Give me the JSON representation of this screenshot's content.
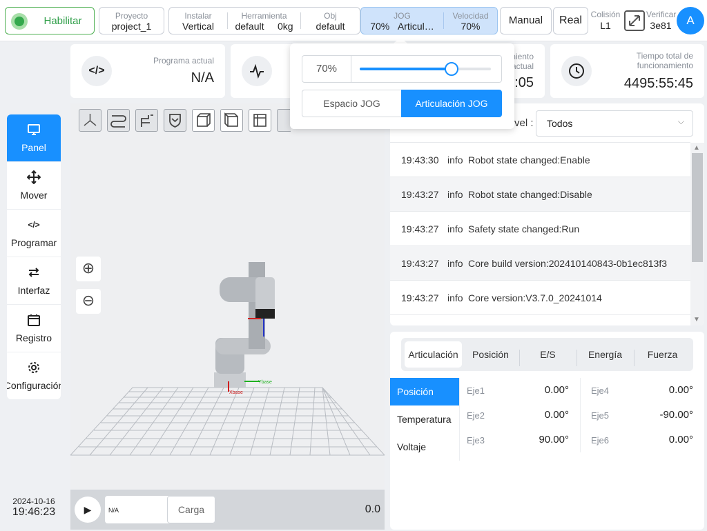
{
  "topbar": {
    "enable_label": "Habilitar",
    "project": {
      "label": "Proyecto",
      "value": "project_1"
    },
    "install": {
      "label": "Instalar",
      "value": "Vertical"
    },
    "tool": {
      "label": "Herramienta",
      "value": "default",
      "weight": "0kg"
    },
    "obj": {
      "label": "Obj",
      "value": "default"
    },
    "jog": {
      "label": "JOG",
      "value1": "70%",
      "value2": "Articul…"
    },
    "speed": {
      "label": "Velocidad",
      "value": "70%"
    },
    "manual_label": "Manual",
    "real_label": "Real",
    "collision": {
      "label": "Colisión",
      "value": "L1"
    },
    "verify": {
      "label": "Verificar",
      "value": "3e81"
    },
    "avatar_letter": "A"
  },
  "cards": {
    "program": {
      "label": "Programa actual",
      "value": "N/A"
    },
    "runtime": {
      "label_frag1": "miento",
      "label_frag2": "actual",
      "value_frag": ":05"
    },
    "total": {
      "label": "Tiempo total de funcionamiento",
      "value": "4495:55:45"
    }
  },
  "jog_popup": {
    "percent": "70%",
    "slider_level": 0.7,
    "space_label": "Espacio JOG",
    "joint_label": "Articulación JOG"
  },
  "sidebar": {
    "items": [
      {
        "label": "Panel",
        "icon": "monitor-icon"
      },
      {
        "label": "Mover",
        "icon": "move-arrows-icon"
      },
      {
        "label": "Programar",
        "icon": "code-icon"
      },
      {
        "label": "Interfaz",
        "icon": "swap-arrows-icon"
      },
      {
        "label": "Registro",
        "icon": "calendar-icon"
      },
      {
        "label": "Configuración",
        "icon": "gear-icon"
      }
    ]
  },
  "datetime": {
    "date": "2024-10-16",
    "time": "19:46:23"
  },
  "viewer": {
    "base_label": "Xbase",
    "y_label": "Ybase"
  },
  "runbar": {
    "program": "N/A",
    "load_label": "Carga",
    "value": "0.0"
  },
  "log": {
    "level_label": "vel :",
    "filter_value": "Todos",
    "rows": [
      {
        "time": "19:43:30",
        "level": "info",
        "msg": "Robot state changed:Enable"
      },
      {
        "time": "19:43:27",
        "level": "info",
        "msg": "Robot state changed:Disable"
      },
      {
        "time": "19:43:27",
        "level": "info",
        "msg": "Safety state changed:Run"
      },
      {
        "time": "19:43:27",
        "level": "info",
        "msg": "Core build version:202410140843-0b1ec813f3"
      },
      {
        "time": "19:43:27",
        "level": "info",
        "msg": "Core version:V3.7.0_20241014"
      }
    ]
  },
  "joints": {
    "tabs": [
      "Articulación",
      "Posición",
      "E/S",
      "Energía",
      "Fuerza"
    ],
    "sub": [
      "Posición",
      "Temperatura",
      "Voltaje"
    ],
    "axes": [
      {
        "label": "Eje1",
        "value": "0.00°"
      },
      {
        "label": "Eje2",
        "value": "0.00°"
      },
      {
        "label": "Eje3",
        "value": "90.00°"
      },
      {
        "label": "Eje4",
        "value": "0.00°"
      },
      {
        "label": "Eje5",
        "value": "-90.00°"
      },
      {
        "label": "Eje6",
        "value": "0.00°"
      }
    ]
  },
  "colors": {
    "accent": "#1890ff",
    "enable": "#33a84c",
    "jog_bg": "#cfe3fb"
  }
}
